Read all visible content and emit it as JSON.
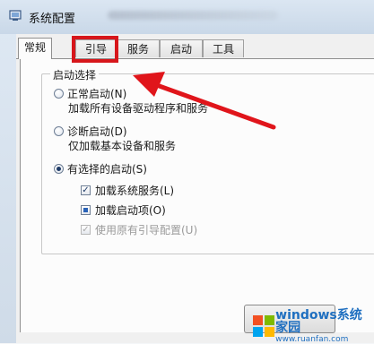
{
  "window": {
    "title": "系统配置"
  },
  "tabs": [
    {
      "label": "常规"
    },
    {
      "label": "引导"
    },
    {
      "label": "服务"
    },
    {
      "label": "启动"
    },
    {
      "label": "工具"
    }
  ],
  "active_tab": "常规",
  "highlighted_tab": "引导",
  "startup": {
    "group_label": "启动选择",
    "normal": {
      "label": "正常启动(N)",
      "desc": "加载所有设备驱动程序和服务"
    },
    "diagnostic": {
      "label": "诊断启动(D)",
      "desc": "仅加载基本设备和服务"
    },
    "selective": {
      "label": "有选择的启动(S)"
    },
    "options": [
      {
        "label": "加载系统服务(L)",
        "state": "checked"
      },
      {
        "label": "加载启动项(O)",
        "state": "indeterminate"
      },
      {
        "label": "使用原有引导配置(U)",
        "state": "disabled-checked"
      }
    ]
  },
  "watermark": {
    "brand": "windows系统家园",
    "url": "www.ruanfan.com"
  },
  "colors": {
    "highlight": "#d7161b",
    "arrow": "#e0151b",
    "watermark": "#1f6fc0"
  }
}
